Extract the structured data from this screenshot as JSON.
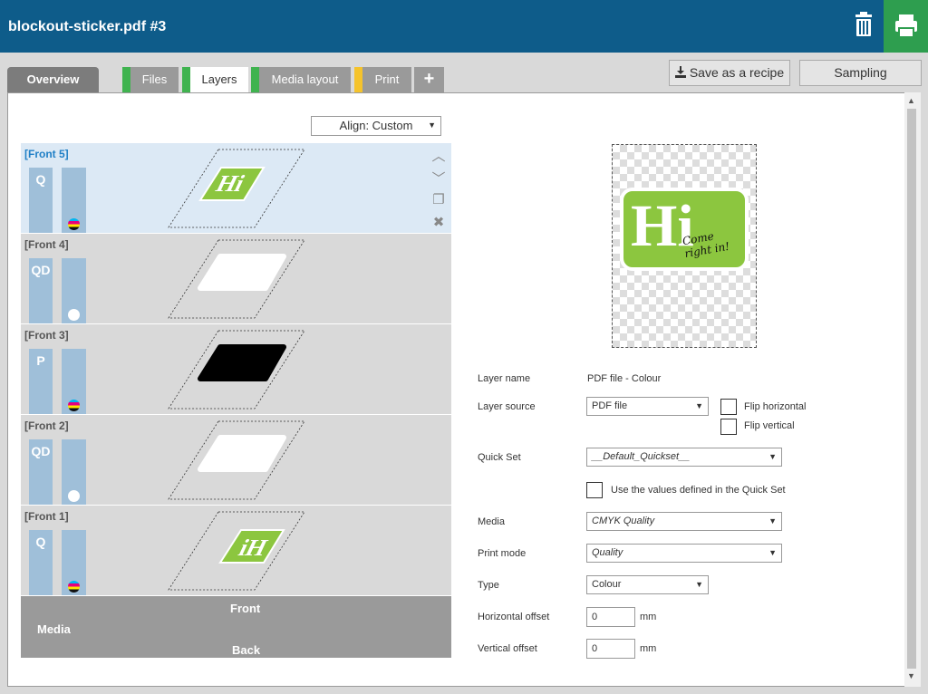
{
  "header": {
    "title": "blockout-sticker.pdf #3",
    "trash_icon": "trash-icon",
    "print_icon": "printer-icon"
  },
  "tabs": [
    {
      "label": "Overview",
      "color": "#7c7c7c"
    },
    {
      "label": "Files",
      "status_color": "#3fb34f"
    },
    {
      "label": "Layers",
      "status_color": "#3fb34f",
      "active": true
    },
    {
      "label": "Media layout",
      "status_color": "#3fb34f"
    },
    {
      "label": "Print",
      "status_color": "#f5c32c"
    },
    {
      "label": "+"
    }
  ],
  "toolbar": {
    "save_recipe_label": "Save as a recipe",
    "sampling_label": "Sampling"
  },
  "align": {
    "value": "Align: Custom"
  },
  "layers": [
    {
      "label": "[Front 5]",
      "mode": "Q",
      "ink": "cmyk",
      "thumb_text": "Hi"
    },
    {
      "label": "[Front 4]",
      "mode": "QD",
      "ink": "white"
    },
    {
      "label": "[Front 3]",
      "mode": "P",
      "ink": "cmyk"
    },
    {
      "label": "[Front 2]",
      "mode": "QD",
      "ink": "white"
    },
    {
      "label": "[Front 1]",
      "mode": "Q",
      "ink": "cmyk",
      "thumb_text": "iH"
    }
  ],
  "media_bar": {
    "label": "Media",
    "front": "Front",
    "back": "Back"
  },
  "preview": {
    "big_text": "Hi",
    "line1": "Come",
    "line2": "right in!"
  },
  "form": {
    "layer_name_label": "Layer name",
    "layer_name_value": "PDF file - Colour",
    "layer_source_label": "Layer source",
    "layer_source_value": "PDF file",
    "flip_horizontal_label": "Flip horizontal",
    "flip_vertical_label": "Flip vertical",
    "quick_set_label": "Quick Set",
    "quick_set_value": "__Default_Quickset__",
    "use_values_label": "Use the values defined in the Quick Set",
    "media_label": "Media",
    "media_value": "CMYK Quality",
    "print_mode_label": "Print mode",
    "print_mode_value": "Quality",
    "type_label": "Type",
    "type_value": "Colour",
    "h_offset_label": "Horizontal offset",
    "h_offset_value": "0",
    "v_offset_label": "Vertical offset",
    "v_offset_value": "0",
    "unit": "mm"
  }
}
